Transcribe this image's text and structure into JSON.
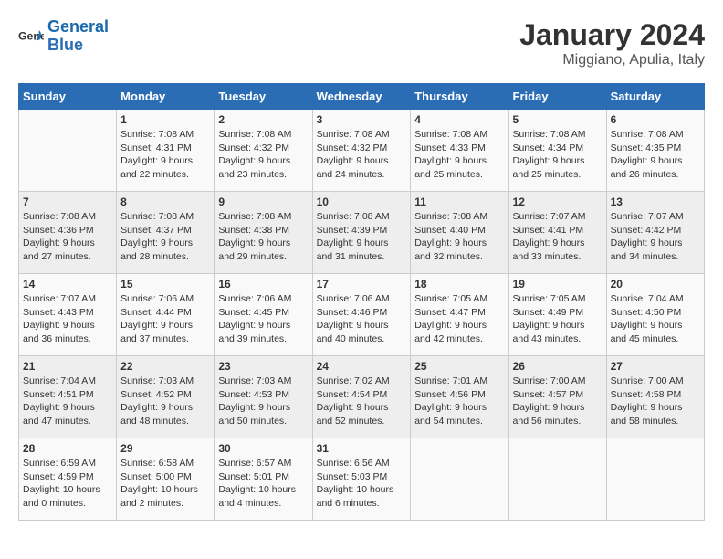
{
  "logo": {
    "text_general": "General",
    "text_blue": "Blue"
  },
  "title": "January 2024",
  "subtitle": "Miggiano, Apulia, Italy",
  "days_of_week": [
    "Sunday",
    "Monday",
    "Tuesday",
    "Wednesday",
    "Thursday",
    "Friday",
    "Saturday"
  ],
  "weeks": [
    [
      {
        "num": "",
        "info": ""
      },
      {
        "num": "1",
        "info": "Sunrise: 7:08 AM\nSunset: 4:31 PM\nDaylight: 9 hours\nand 22 minutes."
      },
      {
        "num": "2",
        "info": "Sunrise: 7:08 AM\nSunset: 4:32 PM\nDaylight: 9 hours\nand 23 minutes."
      },
      {
        "num": "3",
        "info": "Sunrise: 7:08 AM\nSunset: 4:32 PM\nDaylight: 9 hours\nand 24 minutes."
      },
      {
        "num": "4",
        "info": "Sunrise: 7:08 AM\nSunset: 4:33 PM\nDaylight: 9 hours\nand 25 minutes."
      },
      {
        "num": "5",
        "info": "Sunrise: 7:08 AM\nSunset: 4:34 PM\nDaylight: 9 hours\nand 25 minutes."
      },
      {
        "num": "6",
        "info": "Sunrise: 7:08 AM\nSunset: 4:35 PM\nDaylight: 9 hours\nand 26 minutes."
      }
    ],
    [
      {
        "num": "7",
        "info": "Sunrise: 7:08 AM\nSunset: 4:36 PM\nDaylight: 9 hours\nand 27 minutes."
      },
      {
        "num": "8",
        "info": "Sunrise: 7:08 AM\nSunset: 4:37 PM\nDaylight: 9 hours\nand 28 minutes."
      },
      {
        "num": "9",
        "info": "Sunrise: 7:08 AM\nSunset: 4:38 PM\nDaylight: 9 hours\nand 29 minutes."
      },
      {
        "num": "10",
        "info": "Sunrise: 7:08 AM\nSunset: 4:39 PM\nDaylight: 9 hours\nand 31 minutes."
      },
      {
        "num": "11",
        "info": "Sunrise: 7:08 AM\nSunset: 4:40 PM\nDaylight: 9 hours\nand 32 minutes."
      },
      {
        "num": "12",
        "info": "Sunrise: 7:07 AM\nSunset: 4:41 PM\nDaylight: 9 hours\nand 33 minutes."
      },
      {
        "num": "13",
        "info": "Sunrise: 7:07 AM\nSunset: 4:42 PM\nDaylight: 9 hours\nand 34 minutes."
      }
    ],
    [
      {
        "num": "14",
        "info": "Sunrise: 7:07 AM\nSunset: 4:43 PM\nDaylight: 9 hours\nand 36 minutes."
      },
      {
        "num": "15",
        "info": "Sunrise: 7:06 AM\nSunset: 4:44 PM\nDaylight: 9 hours\nand 37 minutes."
      },
      {
        "num": "16",
        "info": "Sunrise: 7:06 AM\nSunset: 4:45 PM\nDaylight: 9 hours\nand 39 minutes."
      },
      {
        "num": "17",
        "info": "Sunrise: 7:06 AM\nSunset: 4:46 PM\nDaylight: 9 hours\nand 40 minutes."
      },
      {
        "num": "18",
        "info": "Sunrise: 7:05 AM\nSunset: 4:47 PM\nDaylight: 9 hours\nand 42 minutes."
      },
      {
        "num": "19",
        "info": "Sunrise: 7:05 AM\nSunset: 4:49 PM\nDaylight: 9 hours\nand 43 minutes."
      },
      {
        "num": "20",
        "info": "Sunrise: 7:04 AM\nSunset: 4:50 PM\nDaylight: 9 hours\nand 45 minutes."
      }
    ],
    [
      {
        "num": "21",
        "info": "Sunrise: 7:04 AM\nSunset: 4:51 PM\nDaylight: 9 hours\nand 47 minutes."
      },
      {
        "num": "22",
        "info": "Sunrise: 7:03 AM\nSunset: 4:52 PM\nDaylight: 9 hours\nand 48 minutes."
      },
      {
        "num": "23",
        "info": "Sunrise: 7:03 AM\nSunset: 4:53 PM\nDaylight: 9 hours\nand 50 minutes."
      },
      {
        "num": "24",
        "info": "Sunrise: 7:02 AM\nSunset: 4:54 PM\nDaylight: 9 hours\nand 52 minutes."
      },
      {
        "num": "25",
        "info": "Sunrise: 7:01 AM\nSunset: 4:56 PM\nDaylight: 9 hours\nand 54 minutes."
      },
      {
        "num": "26",
        "info": "Sunrise: 7:00 AM\nSunset: 4:57 PM\nDaylight: 9 hours\nand 56 minutes."
      },
      {
        "num": "27",
        "info": "Sunrise: 7:00 AM\nSunset: 4:58 PM\nDaylight: 9 hours\nand 58 minutes."
      }
    ],
    [
      {
        "num": "28",
        "info": "Sunrise: 6:59 AM\nSunset: 4:59 PM\nDaylight: 10 hours\nand 0 minutes."
      },
      {
        "num": "29",
        "info": "Sunrise: 6:58 AM\nSunset: 5:00 PM\nDaylight: 10 hours\nand 2 minutes."
      },
      {
        "num": "30",
        "info": "Sunrise: 6:57 AM\nSunset: 5:01 PM\nDaylight: 10 hours\nand 4 minutes."
      },
      {
        "num": "31",
        "info": "Sunrise: 6:56 AM\nSunset: 5:03 PM\nDaylight: 10 hours\nand 6 minutes."
      },
      {
        "num": "",
        "info": ""
      },
      {
        "num": "",
        "info": ""
      },
      {
        "num": "",
        "info": ""
      }
    ]
  ]
}
